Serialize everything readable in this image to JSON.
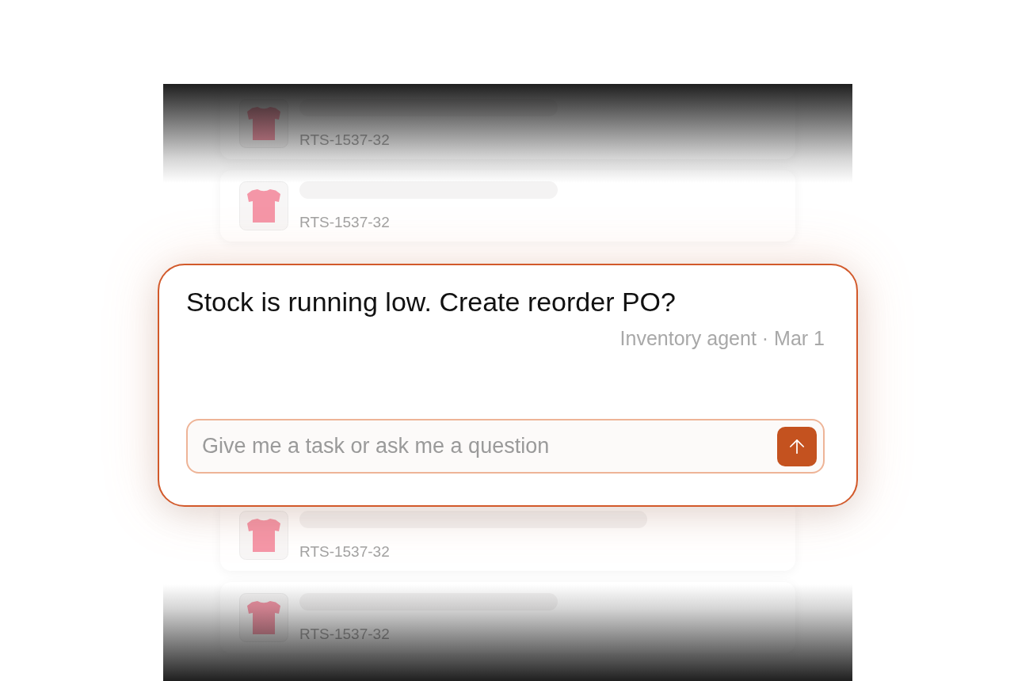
{
  "products_top": [
    {
      "sku": "RTS-1537-32"
    },
    {
      "sku": "RTS-1537-32"
    }
  ],
  "prompt_card": {
    "message": "Stock is running low. Create reorder PO?",
    "byline": "Inventory agent · Mar 1",
    "input": {
      "placeholder": "Give me a task or ask me a question"
    }
  },
  "products_bottom": [
    {
      "sku": "RTS-1537-32"
    },
    {
      "sku": "RTS-1537-32"
    }
  ]
}
